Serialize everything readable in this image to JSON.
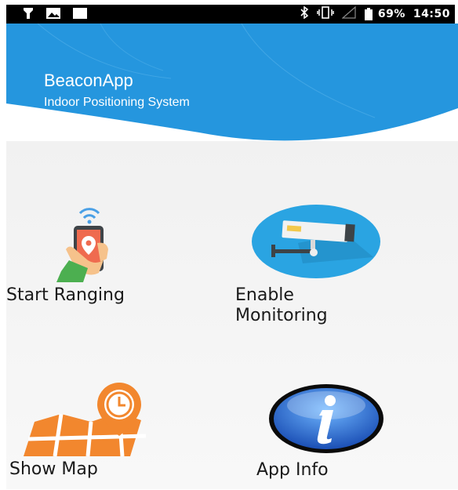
{
  "status_bar": {
    "left_icons": [
      "flashlight-icon",
      "image-icon",
      "notification-icon"
    ],
    "right_icons": [
      "bluetooth-icon",
      "vibrate-icon",
      "signal-icon",
      "battery-icon"
    ],
    "battery": "69%",
    "time": "14:50"
  },
  "header": {
    "title": "BeaconApp",
    "subtitle": "Indoor Positioning System"
  },
  "menu": {
    "start_ranging": "Start Ranging",
    "enable_monitoring": "Enable Monitoring",
    "show_map": "Show Map",
    "app_info": "App Info"
  },
  "colors": {
    "header_blue": "#2596de",
    "accent_orange": "#f2872e",
    "info_blue": "#2a6fd6",
    "status_bar": "#000000"
  }
}
